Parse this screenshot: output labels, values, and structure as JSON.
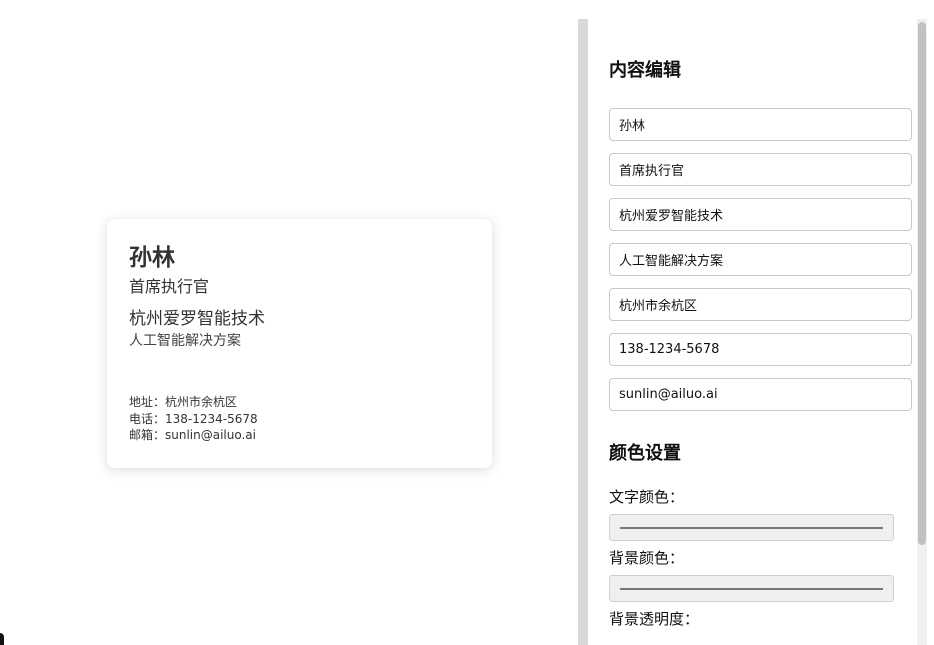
{
  "card": {
    "name": "孙林",
    "title": "首席执行官",
    "company": "杭州爱罗智能技术",
    "slogan": "人工智能解决方案",
    "address_line": "地址：杭州市余杭区",
    "phone_line": "电话：138-1234-5678",
    "email_line": "邮箱：sunlin@ailuo.ai"
  },
  "editor": {
    "content_heading": "内容编辑",
    "fields": {
      "name": "孙林",
      "title": "首席执行官",
      "company": "杭州爱罗智能技术",
      "slogan": "人工智能解决方案",
      "address": "杭州市余杭区",
      "phone": "138-1234-5678",
      "email": "sunlin@ailuo.ai"
    },
    "color_heading": "颜色设置",
    "text_color_label": "文字颜色：",
    "bg_color_label": "背景颜色：",
    "bg_opacity_label": "背景透明度："
  }
}
